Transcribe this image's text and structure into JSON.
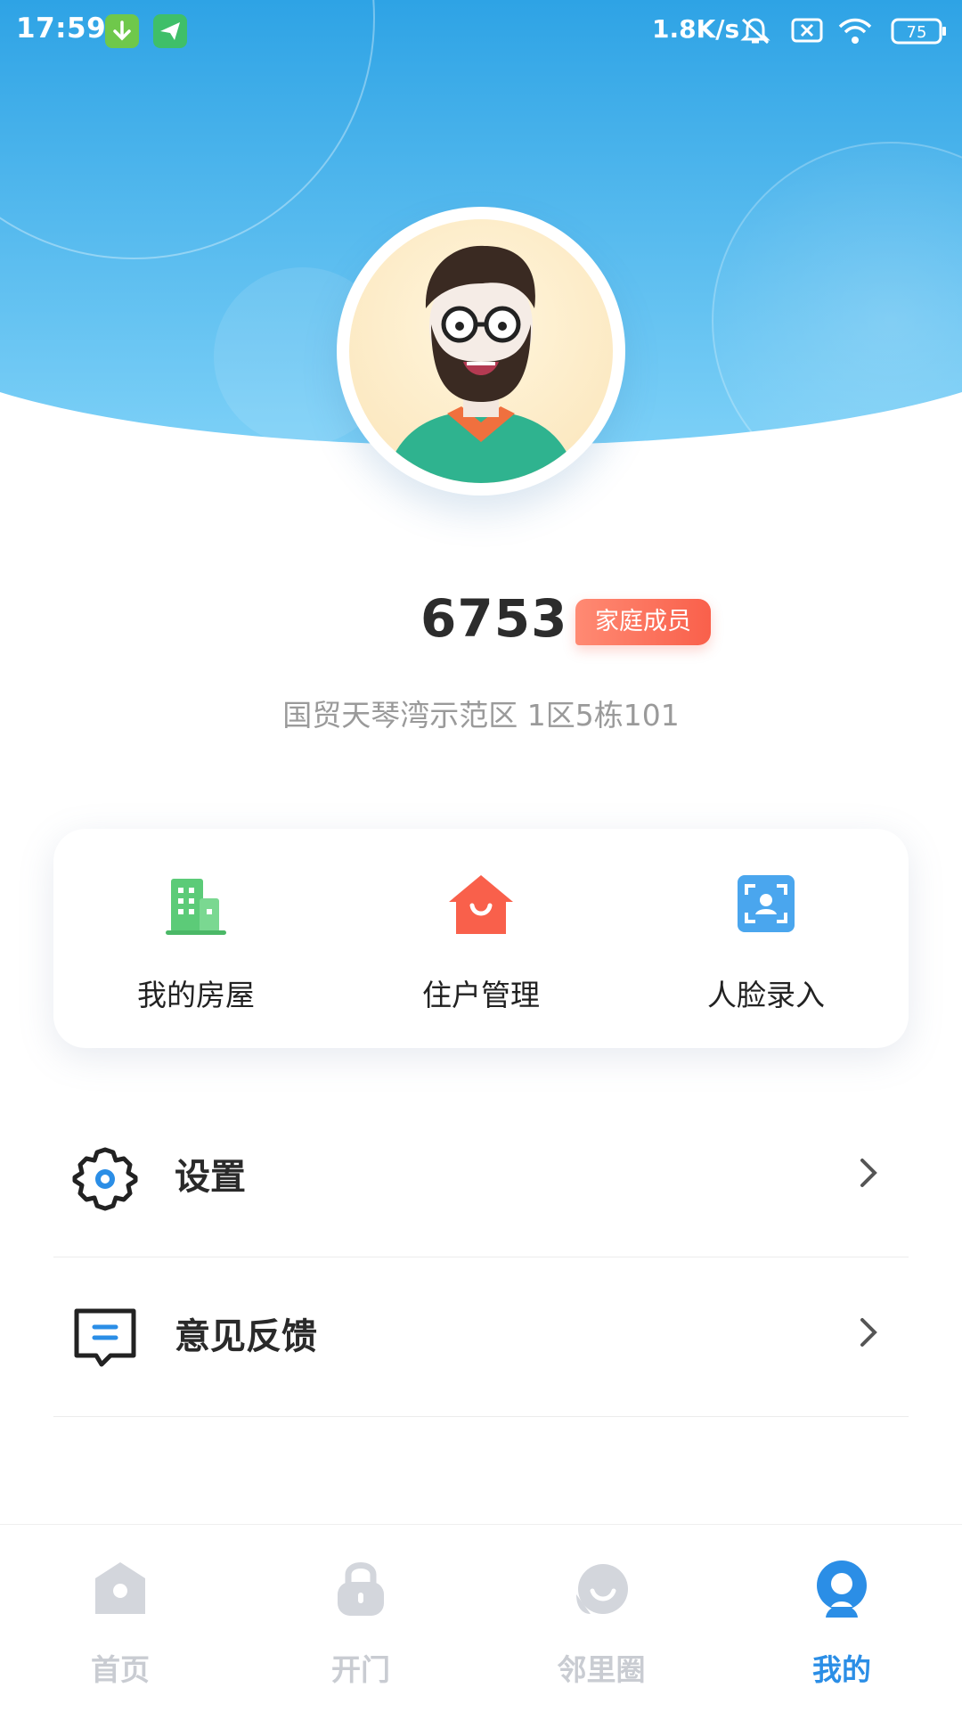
{
  "status_bar": {
    "time": "17:59",
    "net_speed": "1.8K/s",
    "battery": "75",
    "icons": [
      "download-icon",
      "send-icon",
      "mute-icon",
      "sim-off-icon",
      "wifi-icon",
      "battery-icon"
    ]
  },
  "profile": {
    "username": "6753",
    "role_badge": "家庭成员",
    "address": "国贸天琴湾示范区 1区5栋101"
  },
  "quick_actions": [
    {
      "label": "我的房屋",
      "icon": "building-icon",
      "color": "#5ccb78"
    },
    {
      "label": "住户管理",
      "icon": "house-smile-icon",
      "color": "#f9604b"
    },
    {
      "label": "人脸录入",
      "icon": "face-scan-icon",
      "color": "#4aa6ee"
    }
  ],
  "menu": [
    {
      "label": "设置",
      "icon": "gear-icon"
    },
    {
      "label": "意见反馈",
      "icon": "feedback-icon"
    }
  ],
  "tabs": [
    {
      "label": "首页",
      "icon": "home-icon",
      "active": false
    },
    {
      "label": "开门",
      "icon": "lock-icon",
      "active": false
    },
    {
      "label": "邻里圈",
      "icon": "community-icon",
      "active": false
    },
    {
      "label": "我的",
      "icon": "profile-icon",
      "active": true
    }
  ],
  "colors": {
    "accent": "#2b8ee6",
    "header_top": "#30a6e6",
    "header_bottom": "#7fd0f6",
    "badge": "#f9604b"
  }
}
